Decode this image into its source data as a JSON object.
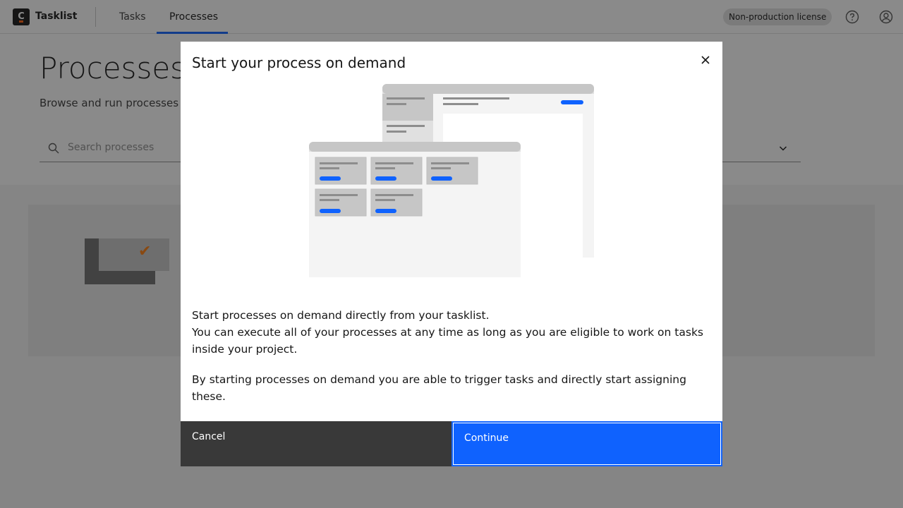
{
  "header": {
    "logo_letter": "C",
    "app_name": "Tasklist",
    "nav": [
      {
        "label": "Tasks",
        "active": false
      },
      {
        "label": "Processes",
        "active": true
      }
    ],
    "license_badge": "Non-production license",
    "icons": {
      "help": "help-icon",
      "user": "user-avatar-icon"
    }
  },
  "page": {
    "title": "Processes",
    "subtitle": "Browse and run processes published to you",
    "search_placeholder": "Search processes"
  },
  "modal": {
    "title": "Start your process on demand",
    "body": {
      "line1": "Start processes on demand directly from your tasklist.",
      "line2": "You can execute all of your processes at any time as long as you are eligible to work on tasks inside your project.",
      "line3": "By starting processes on demand you are able to trigger tasks and directly start assigning these."
    },
    "cancel_label": "Cancel",
    "continue_label": "Continue"
  },
  "colors": {
    "accent": "#0f62fe",
    "brand_orange": "#fc5d0d",
    "overlay": "rgba(22,22,22,0.5)",
    "cancel_bg": "#393939"
  }
}
